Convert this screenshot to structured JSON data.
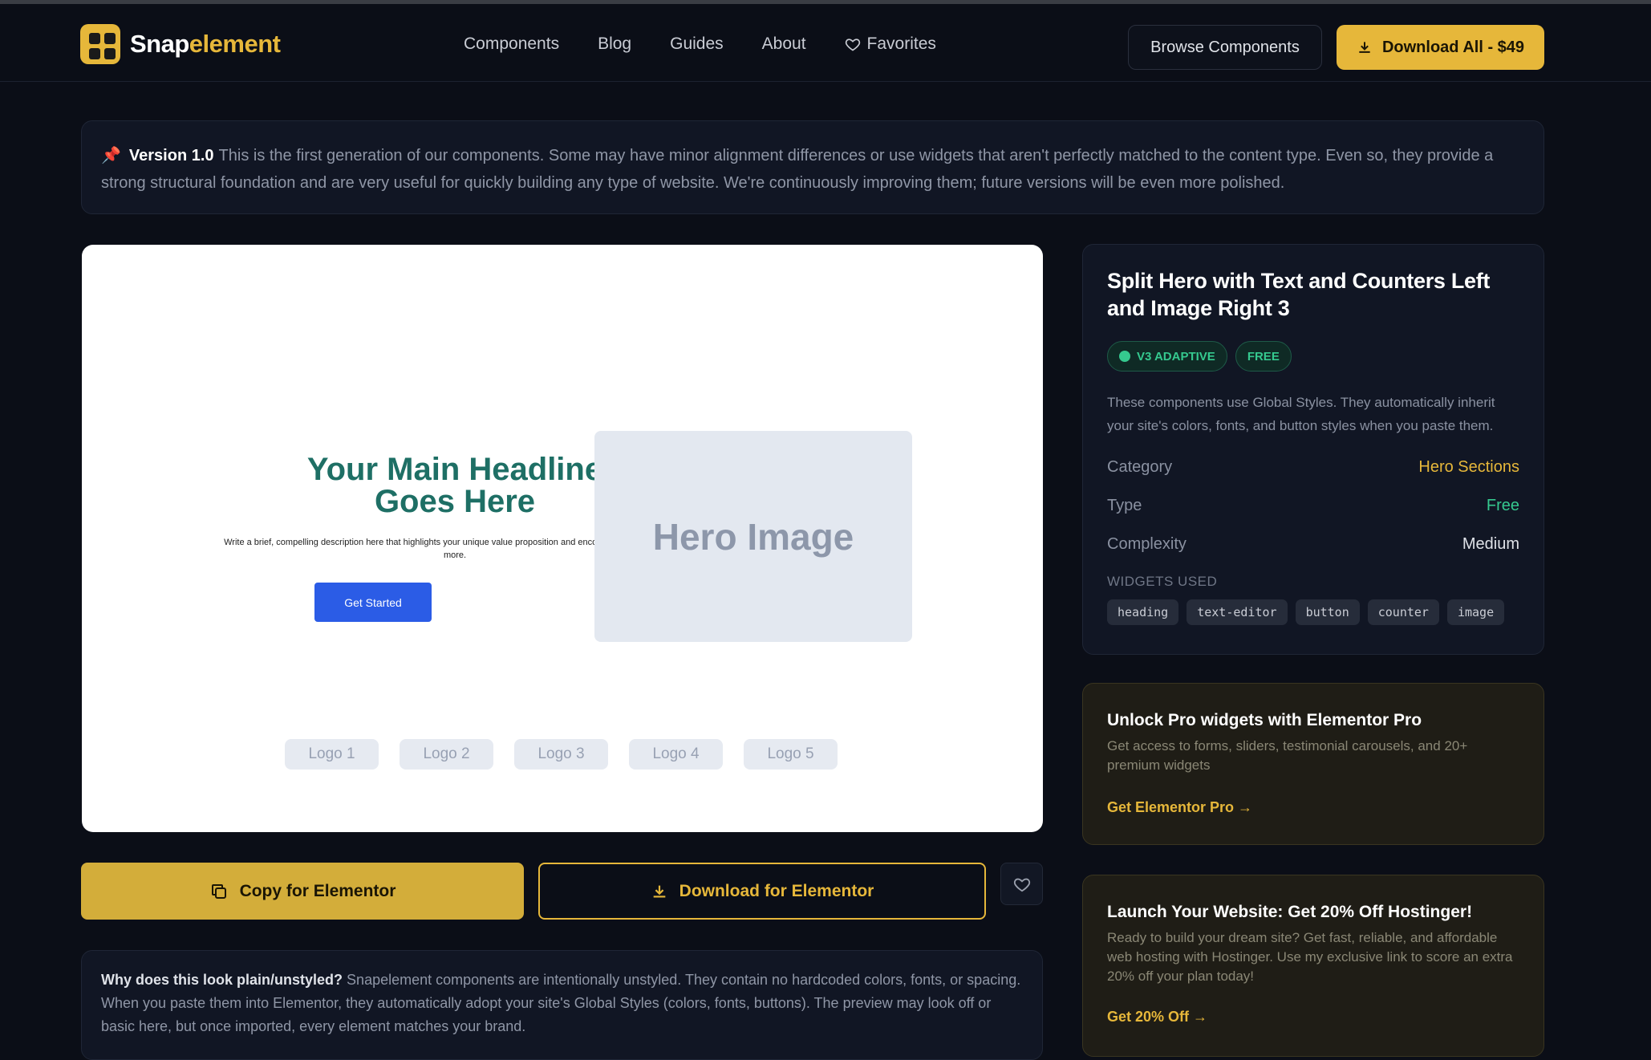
{
  "brand": {
    "name_part1": "Snap",
    "name_part2": "element",
    "accent": "#e6b73a"
  },
  "nav": {
    "items": [
      {
        "label": "Components"
      },
      {
        "label": "Blog"
      },
      {
        "label": "Guides"
      },
      {
        "label": "About"
      },
      {
        "label": "Favorites",
        "icon": "heart-icon"
      }
    ]
  },
  "header": {
    "browse_label": "Browse Components",
    "download_all_label": "Download All - $49"
  },
  "notice": {
    "icon": "pin-icon",
    "version": "Version 1.0",
    "text": "This is the first generation of our components. Some may have minor alignment differences or use widgets that aren't perfectly matched to the content type. Even so, they provide a strong structural foundation and are very useful for quickly building any type of website. We're continuously improving them; future versions will be even more polished."
  },
  "preview": {
    "headline": "Your Main Headline Goes Here",
    "description": "Write a brief, compelling description here that highlights your unique value proposition and encourages visitors to learn more.",
    "button": "Get Started",
    "hero_image": "Hero Image",
    "logos": [
      "Logo 1",
      "Logo 2",
      "Logo 3",
      "Logo 4",
      "Logo 5"
    ]
  },
  "actions": {
    "copy_label": "Copy for Elementor",
    "download_label": "Download for Elementor"
  },
  "why": {
    "question": "Why does this look plain/unstyled?",
    "answer": "Snapelement components are intentionally unstyled. They contain no hardcoded colors, fonts, or spacing. When you paste them into Elementor, they automatically adopt your site's Global Styles (colors, fonts, buttons). The preview may look off or basic here, but once imported, every element matches your brand."
  },
  "component": {
    "title": "Split Hero with Text and Counters Left and Image Right 3",
    "badges": [
      "V3 ADAPTIVE",
      "FREE"
    ],
    "description": "These components use Global Styles. They automatically inherit your site's colors, fonts, and button styles when you paste them.",
    "category_label": "Category",
    "category_value": "Hero Sections",
    "type_label": "Type",
    "type_value": "Free",
    "complexity_label": "Complexity",
    "complexity_value": "Medium",
    "widgets_label": "WIDGETS USED",
    "widgets": [
      "heading",
      "text-editor",
      "button",
      "counter",
      "image"
    ]
  },
  "promos": [
    {
      "title": "Unlock Pro widgets with Elementor Pro",
      "text": "Get access to forms, sliders, testimonial carousels, and 20+ premium widgets",
      "link": "Get Elementor Pro →"
    },
    {
      "title": "Launch Your Website: Get 20% Off Hostinger!",
      "text": "Ready to build your dream site? Get fast, reliable, and affordable web hosting with Hostinger. Use my exclusive link to score an extra 20% off your plan today!",
      "link": "Get 20% Off →"
    }
  ]
}
